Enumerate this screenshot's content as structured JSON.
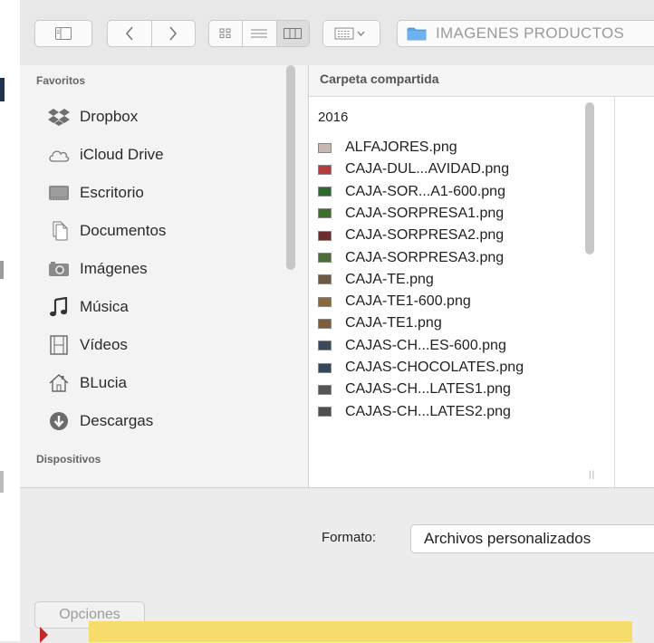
{
  "toolbar": {
    "path_label": "IMAGENES PRODUCTOS",
    "icons": [
      "sidebar-toggle-icon",
      "chevron-left-icon",
      "chevron-right-icon",
      "icon-view-icon",
      "list-view-icon",
      "column-view-icon",
      "arrange-icon",
      "folder-icon"
    ]
  },
  "sidebar": {
    "favorites_heading": "Favoritos",
    "devices_heading": "Dispositivos",
    "items": [
      {
        "label": "Dropbox",
        "icon": "dropbox-icon"
      },
      {
        "label": "iCloud Drive",
        "icon": "cloud-icon"
      },
      {
        "label": "Escritorio",
        "icon": "desktop-icon"
      },
      {
        "label": "Documentos",
        "icon": "documents-icon"
      },
      {
        "label": "Imágenes",
        "icon": "camera-icon"
      },
      {
        "label": "Música",
        "icon": "music-icon"
      },
      {
        "label": "Vídeos",
        "icon": "film-icon"
      },
      {
        "label": "BLucia",
        "icon": "home-icon"
      },
      {
        "label": "Descargas",
        "icon": "download-icon"
      }
    ]
  },
  "browser": {
    "column_header": "Carpeta compartida",
    "folder_name": "2016",
    "files": [
      {
        "name": "ALFAJORES.png",
        "thumb": "#c8b6b0"
      },
      {
        "name": "CAJA-DUL...AVIDAD.png",
        "thumb": "#b43c3c"
      },
      {
        "name": "CAJA-SOR...A1-600.png",
        "thumb": "#2e6a30"
      },
      {
        "name": "CAJA-SORPRESA1.png",
        "thumb": "#3f6e2c"
      },
      {
        "name": "CAJA-SORPRESA2.png",
        "thumb": "#6b2d2d"
      },
      {
        "name": "CAJA-SORPRESA3.png",
        "thumb": "#4a6d3a"
      },
      {
        "name": "CAJA-TE.png",
        "thumb": "#6d5a44"
      },
      {
        "name": "CAJA-TE1-600.png",
        "thumb": "#8a6a3c"
      },
      {
        "name": "CAJA-TE1.png",
        "thumb": "#7c5e3a"
      },
      {
        "name": "CAJAS-CH...ES-600.png",
        "thumb": "#3a4a5e"
      },
      {
        "name": "CAJAS-CHOCOLATES.png",
        "thumb": "#36475a"
      },
      {
        "name": "CAJAS-CH...LATES1.png",
        "thumb": "#555555"
      },
      {
        "name": "CAJAS-CH...LATES2.png",
        "thumb": "#4e4e4e"
      }
    ]
  },
  "bottom": {
    "format_label": "Formato:",
    "format_value": "Archivos personalizados",
    "options_label": "Opciones"
  },
  "colors": {
    "highlight": "#f6dc6a",
    "folder_blue": "#5aa3e8",
    "pointer_red": "#c62828"
  }
}
